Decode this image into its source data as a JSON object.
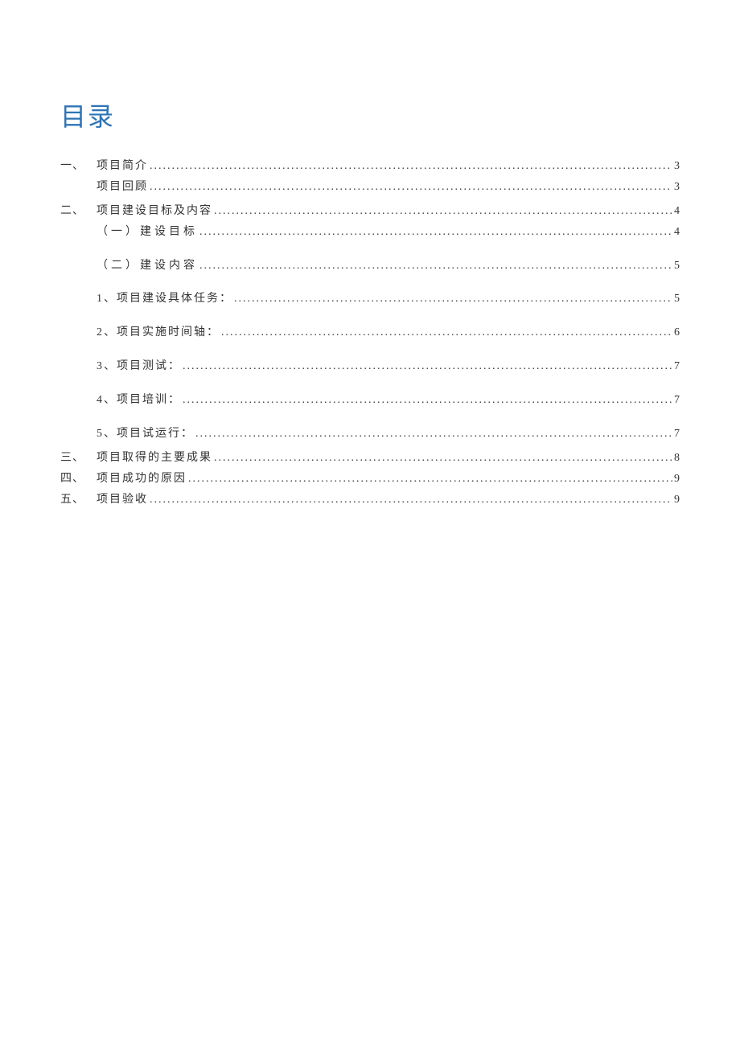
{
  "title": "目录",
  "entries": [
    {
      "marker": "一、",
      "indent": 0,
      "text": "项目简介",
      "page": "3",
      "wide": false,
      "gapAfter": "none"
    },
    {
      "marker": "",
      "indent": 1,
      "text": "项目回顾",
      "page": "3",
      "wide": false,
      "gapAfter": "small"
    },
    {
      "marker": "二、",
      "indent": 0,
      "text": "项目建设目标及内容",
      "page": "4",
      "wide": false,
      "gapAfter": "none"
    },
    {
      "marker": "",
      "indent": 1,
      "text": "（一）建设目标",
      "page": "4",
      "wide": true,
      "gapAfter": "large"
    },
    {
      "marker": "",
      "indent": 1,
      "text": "（二）建设内容",
      "page": "5",
      "wide": true,
      "gapAfter": "large"
    },
    {
      "marker": "",
      "indent": 1,
      "text": "1、项目建设具体任务：",
      "page": "5",
      "wide": false,
      "gapAfter": "large"
    },
    {
      "marker": "",
      "indent": 1,
      "text": "2、项目实施时间轴：",
      "page": "6",
      "wide": false,
      "gapAfter": "large"
    },
    {
      "marker": "",
      "indent": 1,
      "text": "3、项目测试：",
      "page": "7",
      "wide": false,
      "gapAfter": "large"
    },
    {
      "marker": "",
      "indent": 1,
      "text": "4、项目培训：",
      "page": "7",
      "wide": false,
      "gapAfter": "large"
    },
    {
      "marker": "",
      "indent": 1,
      "text": "5、项目试运行：",
      "page": "7",
      "wide": false,
      "gapAfter": "small"
    },
    {
      "marker": "三、",
      "indent": 0,
      "text": "项目取得的主要成果",
      "page": "8",
      "wide": false,
      "gapAfter": "none"
    },
    {
      "marker": "四、",
      "indent": 0,
      "text": "项目成功的原因",
      "page": "9",
      "wide": false,
      "gapAfter": "none"
    },
    {
      "marker": "五、",
      "indent": 0,
      "text": "项目验收",
      "page": "9",
      "wide": false,
      "gapAfter": "none"
    }
  ]
}
